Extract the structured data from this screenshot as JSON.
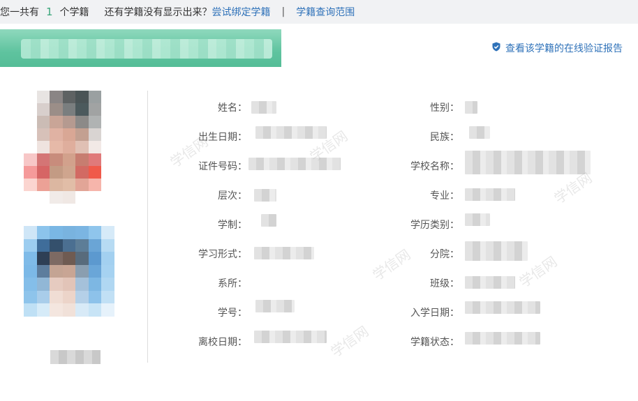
{
  "topbar": {
    "prefix": "您一共有",
    "count": "1",
    "suffix": "个学籍",
    "question": "还有学籍没有显示出来？",
    "bind_link": "尝试绑定学籍",
    "separator": "|",
    "scope_link": "学籍查询范围"
  },
  "card": {
    "verify_link": "查看该学籍的在线验证报告",
    "verify_icon": "shield-check-icon",
    "banner_color": "#67c9a5",
    "link_color": "#2f72b9"
  },
  "fields_left": [
    {
      "label": "姓名："
    },
    {
      "label": "出生日期："
    },
    {
      "label": "证件号码："
    },
    {
      "label": "层次："
    },
    {
      "label": "学制："
    },
    {
      "label": "学习形式："
    },
    {
      "label": "系所："
    },
    {
      "label": "学号："
    },
    {
      "label": "离校日期："
    }
  ],
  "fields_right": [
    {
      "label": "性别："
    },
    {
      "label": "民族："
    },
    {
      "label": "学校名称："
    },
    {
      "label": "专业："
    },
    {
      "label": "学历类别："
    },
    {
      "label": "分院："
    },
    {
      "label": "班级："
    },
    {
      "label": "入学日期："
    },
    {
      "label": "学籍状态："
    }
  ],
  "watermark": "学信网"
}
